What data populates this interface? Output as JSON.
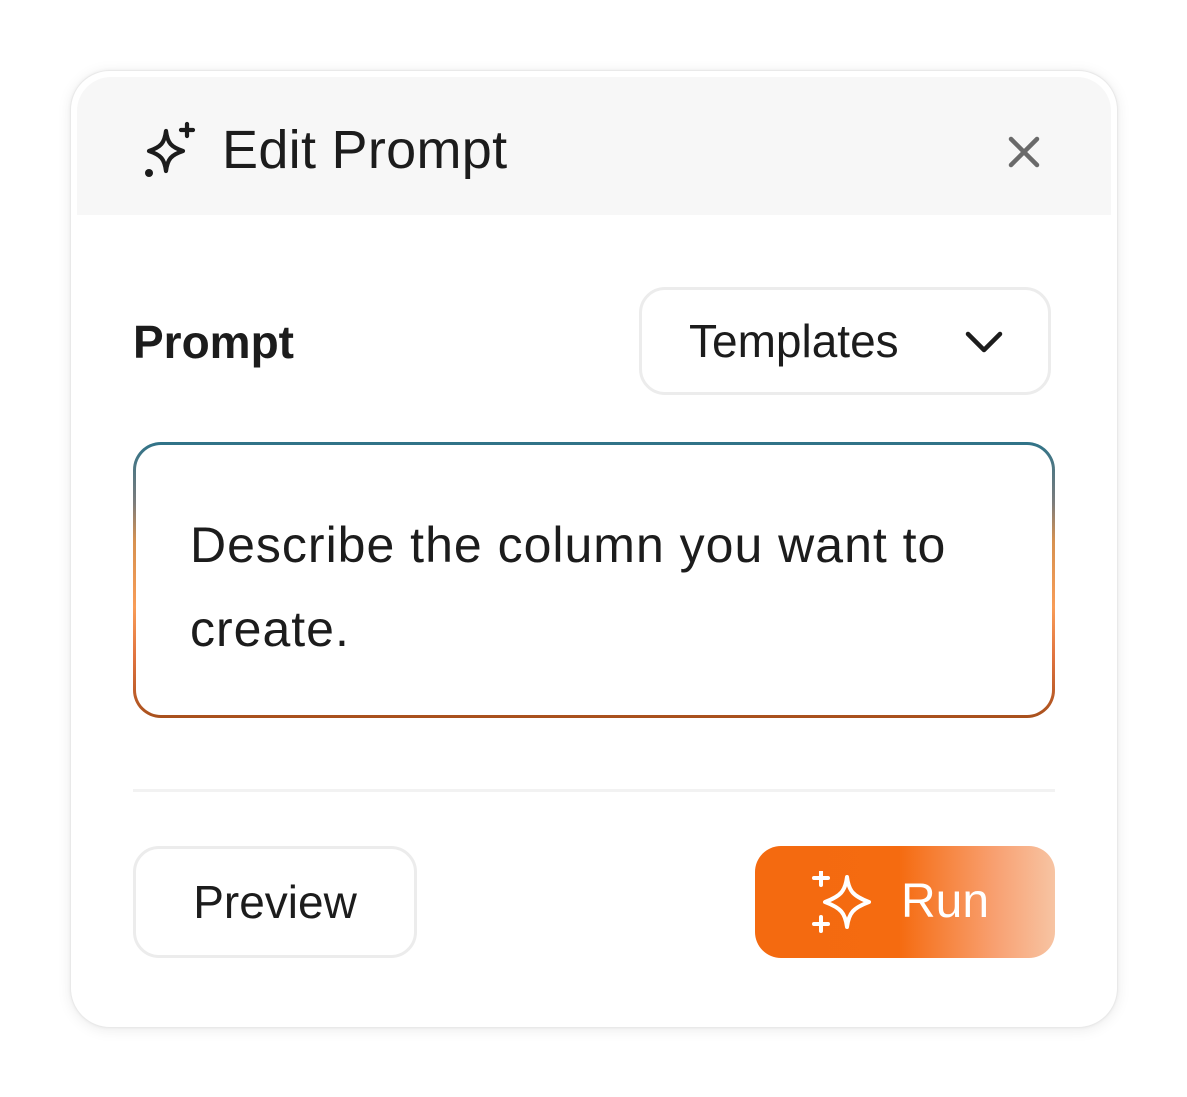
{
  "dialog": {
    "title": "Edit Prompt",
    "header_icon": "sparkles-icon",
    "close_icon": "close-icon"
  },
  "prompt": {
    "label": "Prompt",
    "templates_label": "Templates",
    "templates_icon": "chevron-down-icon",
    "placeholder": "Describe the column you want to create."
  },
  "footer": {
    "preview_label": "Preview",
    "run_label": "Run",
    "run_icon": "sparkles-icon"
  },
  "colors": {
    "accent": "#f56b10",
    "text": "#1c1c1c",
    "header_bg": "#f7f7f7"
  }
}
